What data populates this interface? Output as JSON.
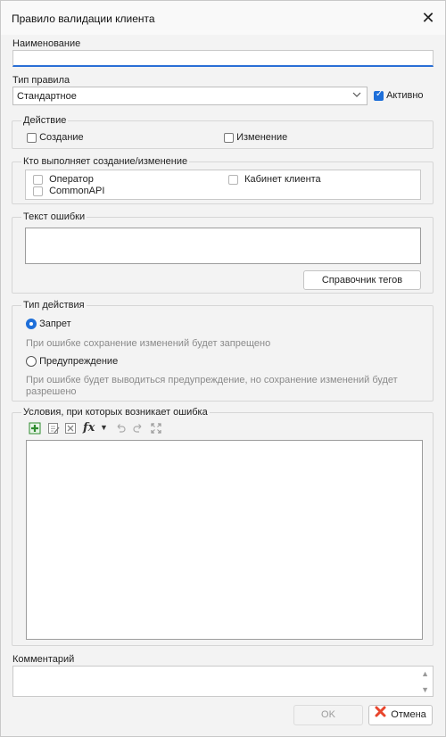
{
  "window": {
    "title": "Правило валидации клиента",
    "close_glyph": "✕"
  },
  "name_field": {
    "label": "Наименование",
    "value": ""
  },
  "rule_type": {
    "label": "Тип правила",
    "selected": "Стандартное",
    "active_label": "Активно",
    "active_checked": true
  },
  "action_group": {
    "title": "Действие",
    "create_label": "Создание",
    "edit_label": "Изменение"
  },
  "performer_group": {
    "title": "Кто выполняет создание/изменение",
    "operator": "Оператор",
    "commonapi": "CommonAPI",
    "cabinet": "Кабинет клиента"
  },
  "error_text_group": {
    "title": "Текст ошибки",
    "value": "",
    "tags_button": "Справочник тегов"
  },
  "action_type_group": {
    "title": "Тип действия",
    "deny_label": "Запрет",
    "deny_hint": "При ошибке сохранение изменений будет запрещено",
    "warn_label": "Предупреждение",
    "warn_hint": "При ошибке будет выводиться предупреждение, но сохранение изменений будет разрешено",
    "selected": "deny"
  },
  "conditions_group": {
    "title": "Условия, при которых возникает ошибка",
    "fx_label": "fx"
  },
  "comment": {
    "label": "Комментарий",
    "value": ""
  },
  "buttons": {
    "ok": "OK",
    "cancel": "Отмена"
  },
  "colors": {
    "accent": "#1e6fd9",
    "cancel_icon": "#e8452c",
    "add_icon": "#2e8b2e"
  },
  "icons": [
    "close-icon",
    "chevron-down-icon",
    "add-condition-icon",
    "edit-condition-icon",
    "delete-condition-icon",
    "fx-icon",
    "dropdown-arrow-icon",
    "undo-icon",
    "redo-icon",
    "expand-icon",
    "scroll-up-icon",
    "scroll-down-icon",
    "cancel-icon"
  ]
}
